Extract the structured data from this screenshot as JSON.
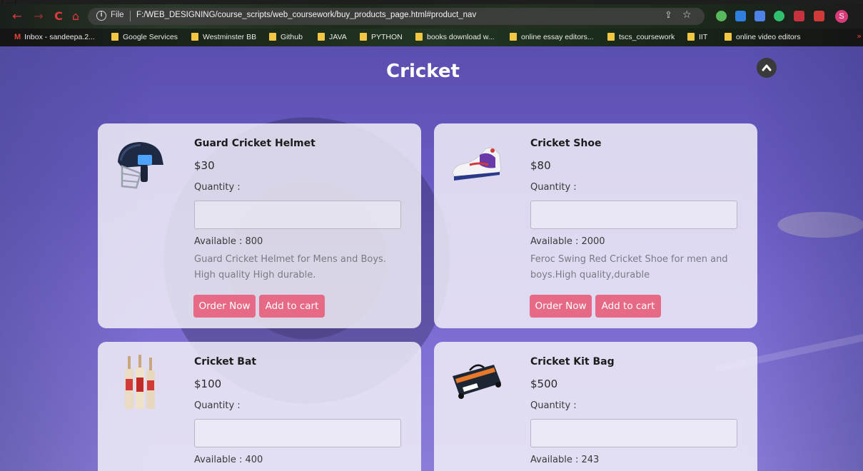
{
  "browser": {
    "fragment_label": "[ ... ]",
    "nav": {
      "back": "←",
      "forward": "→",
      "reload": "C",
      "home": "⌂"
    },
    "address": {
      "scheme_label": "File",
      "url": "F:/WEB_DESIGNING/course_scripts/web_coursework/buy_products_page.html#product_nav"
    },
    "profile_initial": "S",
    "bookmarks": [
      {
        "label": "Inbox - sandeepa.2...",
        "type": "gmail"
      },
      {
        "label": "Google Services",
        "type": "folder"
      },
      {
        "label": "Westminster BB",
        "type": "folder"
      },
      {
        "label": "Github",
        "type": "folder"
      },
      {
        "label": "JAVA",
        "type": "folder"
      },
      {
        "label": "PYTHON",
        "type": "folder"
      },
      {
        "label": "books download w...",
        "type": "folder"
      },
      {
        "label": "online essay editors...",
        "type": "folder"
      },
      {
        "label": "tscs_coursework",
        "type": "folder"
      },
      {
        "label": "IIT",
        "type": "folder"
      },
      {
        "label": "online video editors",
        "type": "folder"
      }
    ]
  },
  "page": {
    "title": "Cricket",
    "colors": {
      "accent_button": "#e66a86",
      "card_bg": "#f3f1f8",
      "overlay": "#6a5cc4"
    },
    "products": [
      {
        "name": "Guard Cricket Helmet",
        "price": "$30",
        "quantity_label": "Quantity :",
        "quantity_value": "",
        "available": "Available : 800",
        "description": "Guard Cricket Helmet for Mens and Boys. High quality High durable.",
        "order_label": "Order Now",
        "cart_label": "Add to cart",
        "image": "cricket-helmet-image"
      },
      {
        "name": "Cricket Shoe",
        "price": "$80",
        "quantity_label": "Quantity :",
        "quantity_value": "",
        "available": "Available : 2000",
        "description": "Feroc Swing Red Cricket Shoe for men and boys.High quality,durable",
        "order_label": "Order Now",
        "cart_label": "Add to cart",
        "image": "cricket-shoe-image"
      },
      {
        "name": "Cricket Bat",
        "price": "$100",
        "quantity_label": "Quantity :",
        "quantity_value": "",
        "available": "Available : 400",
        "image": "cricket-bat-image"
      },
      {
        "name": "Cricket Kit Bag",
        "price": "$500",
        "quantity_label": "Quantity :",
        "quantity_value": "",
        "available": "Available : 243",
        "image": "cricket-kit-bag-image"
      }
    ]
  }
}
